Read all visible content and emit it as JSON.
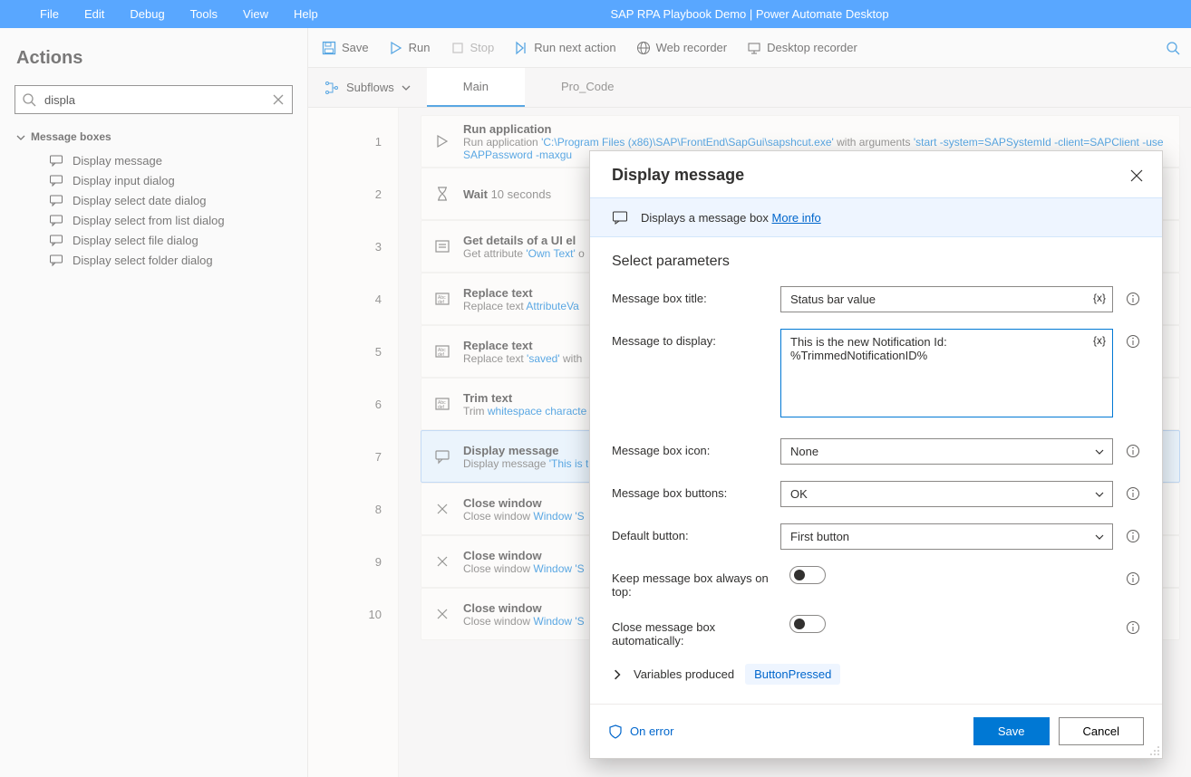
{
  "menubar": {
    "items": [
      "File",
      "Edit",
      "Debug",
      "Tools",
      "View",
      "Help"
    ],
    "title": "SAP RPA Playbook Demo | Power Automate Desktop"
  },
  "toolbar": {
    "save": "Save",
    "run": "Run",
    "stop": "Stop",
    "run_next": "Run next action",
    "web_rec": "Web recorder",
    "desk_rec": "Desktop recorder"
  },
  "left": {
    "title": "Actions",
    "search_value": "displa",
    "group": "Message boxes",
    "items": [
      "Display message",
      "Display input dialog",
      "Display select date dialog",
      "Display select from list dialog",
      "Display select file dialog",
      "Display select folder dialog"
    ]
  },
  "subflows_label": "Subflows",
  "tabs": [
    "Main",
    "Pro_Code"
  ],
  "steps": [
    {
      "n": "1",
      "title": "Run application",
      "sub_pre": "Run application ",
      "lit": "'C:\\Program Files (x86)\\SAP\\FrontEnd\\SapGui\\sapshcut.exe'",
      "sub_mid": " with arguments ",
      "lit2": "'start -system=",
      "v1": "SAPSystemId",
      "mid2": " -client=",
      "v2": "SAPClient",
      "mid3": " -use",
      "line2_v": "SAPPassword",
      "line2_tail": " -maxgu",
      "icon": "play"
    },
    {
      "n": "2",
      "title": "Wait",
      "inline": "10 seconds",
      "icon": "hourglass"
    },
    {
      "n": "3",
      "title": "Get details of a UI el",
      "sub_pre": "Get attribute ",
      "lit": "'Own Text'",
      "sub_tail": " o",
      "icon": "detail"
    },
    {
      "n": "4",
      "title": "Replace text",
      "sub_pre": "Replace text ",
      "v": "AttributeVa",
      "icon": "abc"
    },
    {
      "n": "5",
      "title": "Replace text",
      "sub_pre": "Replace text ",
      "lit": "'saved'",
      "sub_tail": " with ",
      "icon": "abc"
    },
    {
      "n": "6",
      "title": "Trim text",
      "sub_pre": "Trim ",
      "v": "whitespace characte",
      "icon": "abc"
    },
    {
      "n": "7",
      "title": "Display message",
      "sub_pre": "Display message ",
      "lit": "'This is t",
      "icon": "msg",
      "selected": true
    },
    {
      "n": "8",
      "title": "Close window",
      "sub_pre": "Close window ",
      "v": "Window 'S",
      "icon": "x"
    },
    {
      "n": "9",
      "title": "Close window",
      "sub_pre": "Close window ",
      "v": "Window 'S",
      "icon": "x"
    },
    {
      "n": "10",
      "title": "Close window",
      "sub_pre": "Close window ",
      "v": "Window 'S",
      "icon": "x"
    }
  ],
  "dialog": {
    "title": "Display message",
    "banner_text": "Displays a message box ",
    "banner_link": "More info",
    "section": "Select parameters",
    "params": {
      "title_label": "Message box title:",
      "title_value": "Status bar value",
      "message_label": "Message to display:",
      "message_value": "This is the new Notification Id: %TrimmedNotificationID%",
      "icon_label": "Message box icon:",
      "icon_value": "None",
      "buttons_label": "Message box buttons:",
      "buttons_value": "OK",
      "default_label": "Default button:",
      "default_value": "First button",
      "ontop_label": "Keep message box always on top:",
      "autoclose_label": "Close message box automatically:"
    },
    "vars_label": "Variables produced",
    "var_chip": "ButtonPressed",
    "on_error": "On error",
    "save": "Save",
    "cancel": "Cancel"
  }
}
